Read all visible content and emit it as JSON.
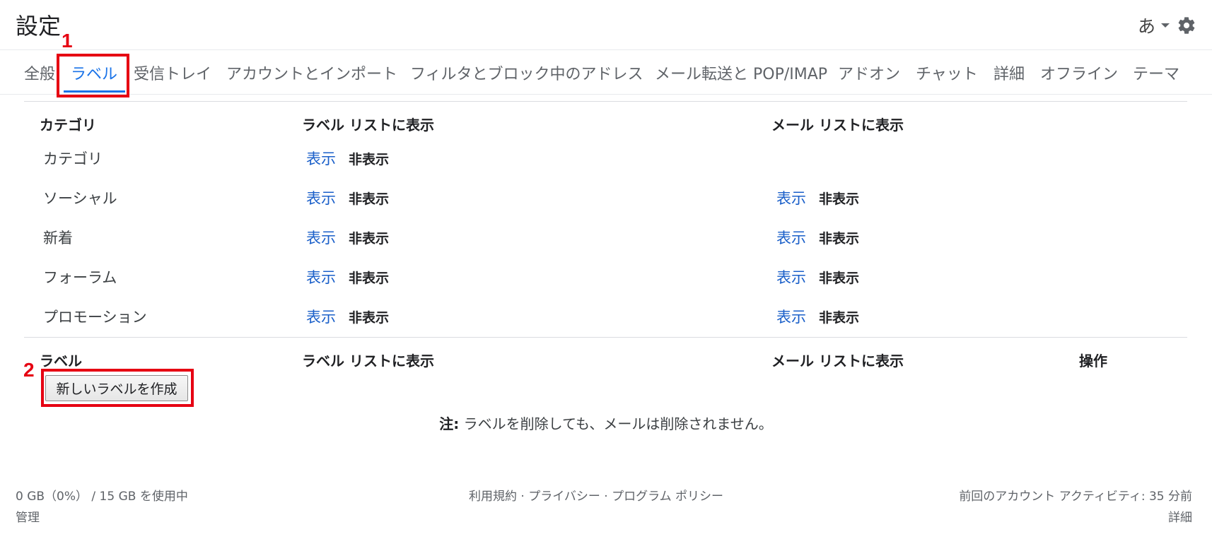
{
  "header": {
    "title": "設定",
    "input_mode": "あ",
    "caret_icon": "dropdown-caret-icon",
    "settings_icon": "gear-icon"
  },
  "tabs": [
    {
      "label": "全般"
    },
    {
      "label": "ラベル",
      "active": true
    },
    {
      "label": "受信トレイ"
    },
    {
      "label": "アカウントとインポート"
    },
    {
      "label": "フィルタとブロック中のアドレス"
    },
    {
      "label": "メール転送と POP/IMAP"
    },
    {
      "label": "アドオン"
    },
    {
      "label": "チャット"
    },
    {
      "label": "詳細"
    },
    {
      "label": "オフライン"
    },
    {
      "label": "テーマ"
    }
  ],
  "categories_section": {
    "col_name": "カテゴリ",
    "col_label_list": "ラベル リストに表示",
    "col_mail_list": "メール リストに表示",
    "rows": [
      {
        "name": "カテゴリ",
        "label_show": "表示",
        "label_hide": "非表示",
        "mail_show": "",
        "mail_hide": ""
      },
      {
        "name": "ソーシャル",
        "label_show": "表示",
        "label_hide": "非表示",
        "mail_show": "表示",
        "mail_hide": "非表示"
      },
      {
        "name": "新着",
        "label_show": "表示",
        "label_hide": "非表示",
        "mail_show": "表示",
        "mail_hide": "非表示"
      },
      {
        "name": "フォーラム",
        "label_show": "表示",
        "label_hide": "非表示",
        "mail_show": "表示",
        "mail_hide": "非表示"
      },
      {
        "name": "プロモーション",
        "label_show": "表示",
        "label_hide": "非表示",
        "mail_show": "表示",
        "mail_hide": "非表示"
      }
    ]
  },
  "labels_section": {
    "col_name": "ラベル",
    "col_label_list": "ラベル リストに表示",
    "col_mail_list": "メール リストに表示",
    "col_actions": "操作",
    "create_button": "新しいラベルを作成",
    "note_prefix": "注:",
    "note_text": " ラベルを削除しても、メールは削除されません。"
  },
  "footer": {
    "storage": "0 GB（0%） / 15 GB を使用中",
    "manage": "管理",
    "links": "利用規約 · プライバシー · プログラム ポリシー",
    "activity": "前回のアカウント アクティビティ: 35 分前",
    "details": "詳細"
  },
  "annotations": {
    "marker_1": "1",
    "marker_2": "2",
    "color": "#e60012"
  }
}
